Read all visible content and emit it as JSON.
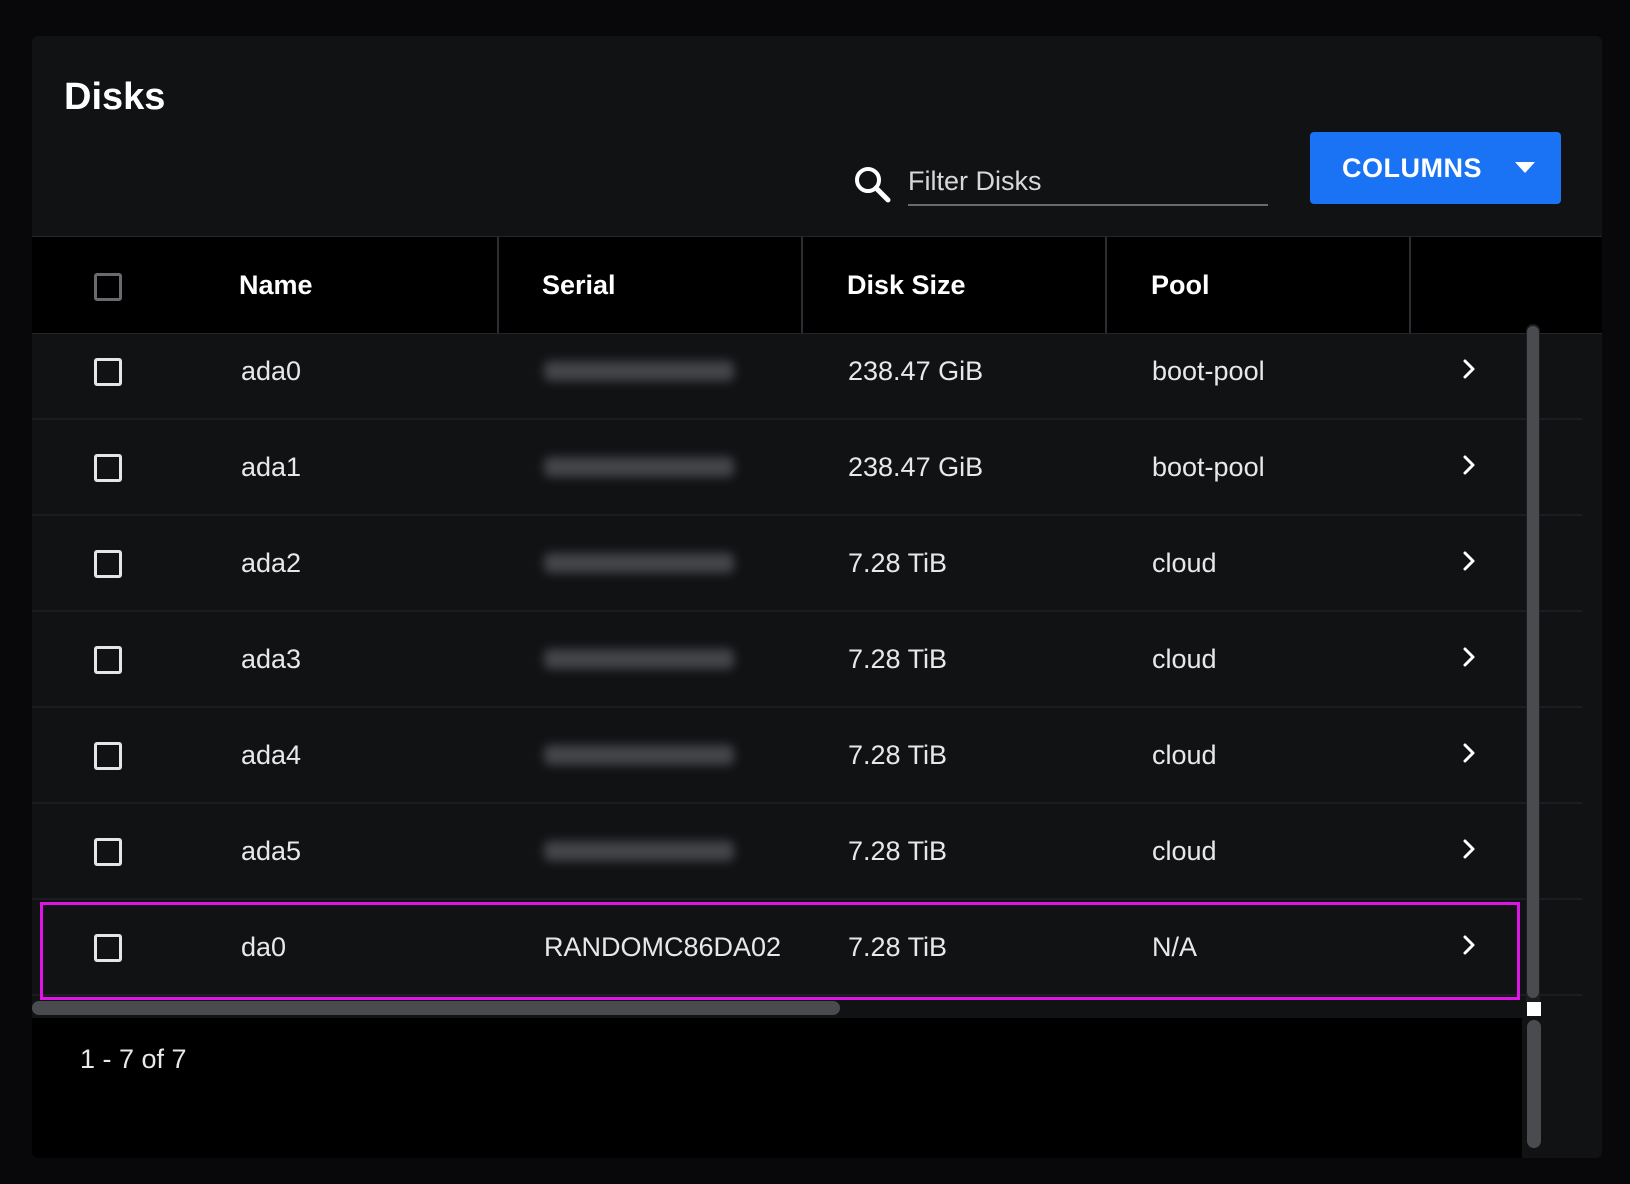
{
  "header": {
    "title": "Disks",
    "filter_placeholder": "Filter Disks",
    "columns_label": "COLUMNS"
  },
  "table": {
    "columns": [
      "Name",
      "Serial",
      "Disk Size",
      "Pool"
    ],
    "rows": [
      {
        "name": "ada0",
        "serial": "",
        "size": "238.47 GiB",
        "pool": "boot-pool"
      },
      {
        "name": "ada1",
        "serial": "",
        "size": "238.47 GiB",
        "pool": "boot-pool"
      },
      {
        "name": "ada2",
        "serial": "",
        "size": "7.28 TiB",
        "pool": "cloud"
      },
      {
        "name": "ada3",
        "serial": "",
        "size": "7.28 TiB",
        "pool": "cloud"
      },
      {
        "name": "ada4",
        "serial": "",
        "size": "7.28 TiB",
        "pool": "cloud"
      },
      {
        "name": "ada5",
        "serial": "",
        "size": "7.28 TiB",
        "pool": "cloud"
      },
      {
        "name": "da0",
        "serial": "RANDOMC86DA02",
        "size": "7.28 TiB",
        "pool": "N/A"
      }
    ]
  },
  "footer": {
    "paginator": "1 - 7 of 7"
  },
  "icons": {
    "search": "search-icon",
    "caret": "caret-down-icon",
    "row_action": "chevron-right-icon"
  },
  "colors": {
    "accent": "#1a73f5",
    "highlight": "#e014e6"
  }
}
